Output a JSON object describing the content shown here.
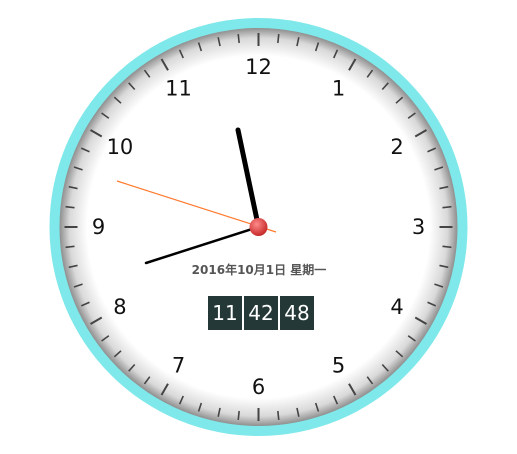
{
  "clock": {
    "numerals": [
      "12",
      "1",
      "2",
      "3",
      "4",
      "5",
      "6",
      "7",
      "8",
      "9",
      "10",
      "11"
    ],
    "date_text": "2016年10月1日 星期一",
    "time": {
      "hours": "11",
      "minutes": "42",
      "seconds": "48"
    },
    "colors": {
      "rim": "#7fe8ea",
      "face": "#ffffff",
      "hands": "#000000",
      "second_hand": "#ff7a2e",
      "center_cap": "#e23b3b",
      "digital_bg": "#243838"
    }
  }
}
